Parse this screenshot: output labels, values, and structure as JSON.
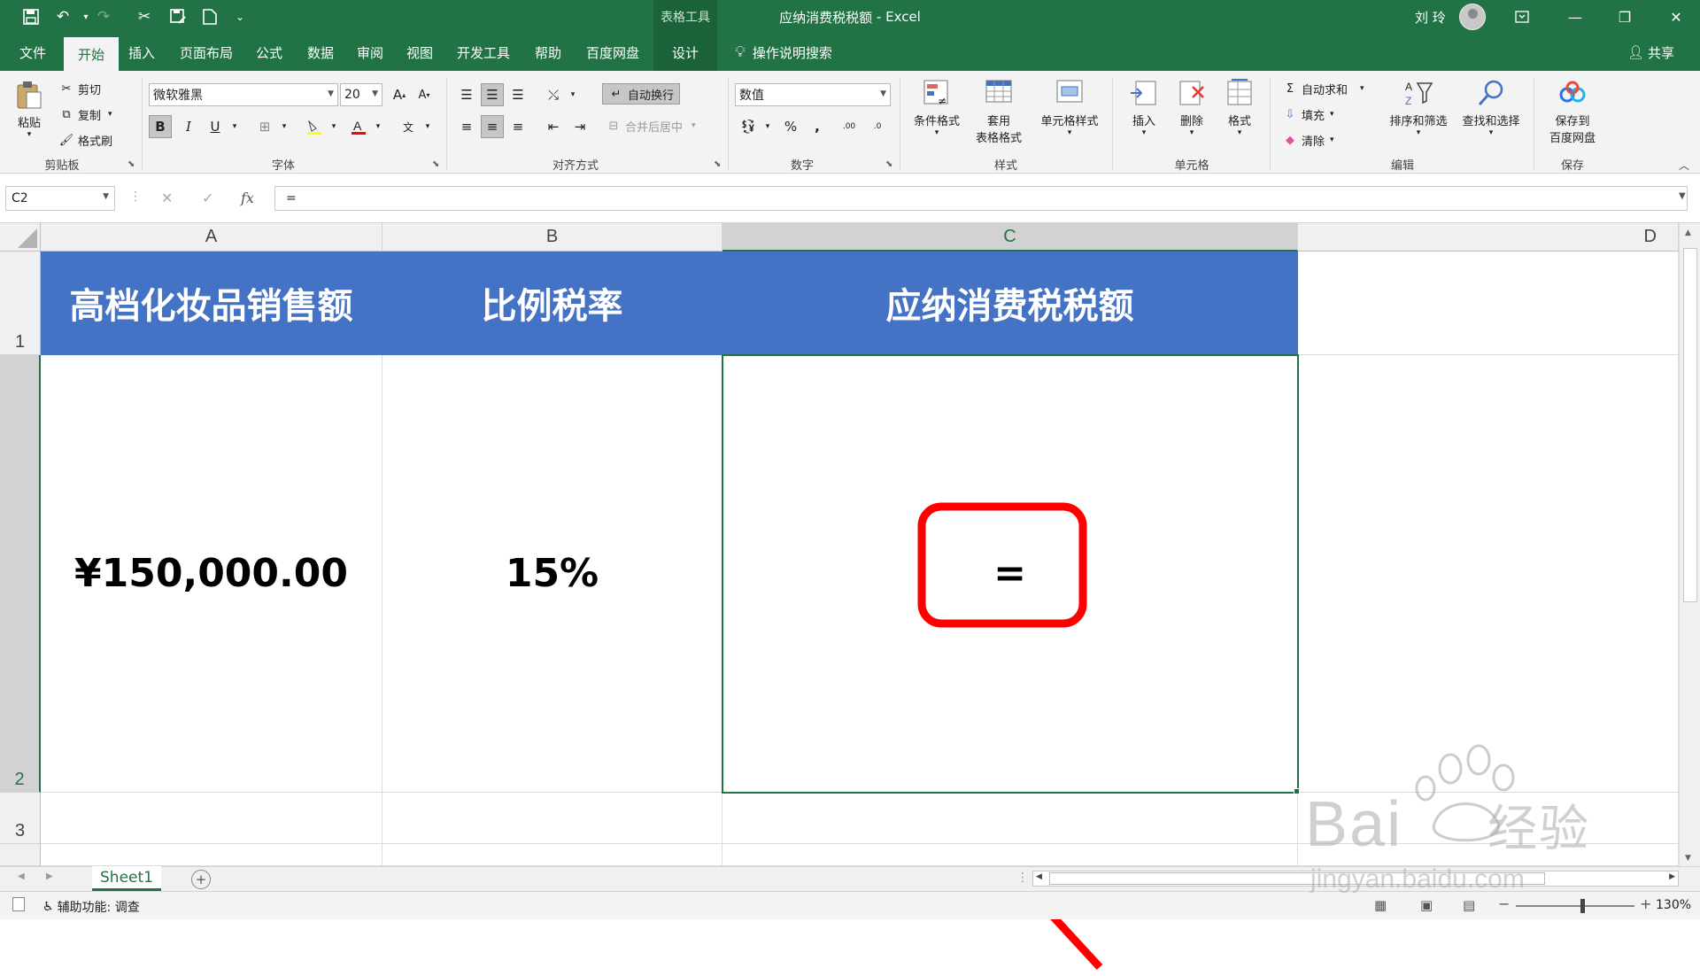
{
  "window": {
    "context_tab": "表格工具",
    "title": "应纳消费税税额",
    "app_name": "Excel",
    "title_separator": " - ",
    "user": "刘 玲"
  },
  "tabs": [
    "文件",
    "开始",
    "插入",
    "页面布局",
    "公式",
    "数据",
    "审阅",
    "视图",
    "开发工具",
    "帮助",
    "百度网盘",
    "设计"
  ],
  "active_tab": "开始",
  "tell_me": "操作说明搜索",
  "share": "共享",
  "ribbon": {
    "clipboard": {
      "paste": "粘贴",
      "cut": "剪切",
      "copy": "复制",
      "format_painter": "格式刷",
      "label": "剪贴板"
    },
    "font": {
      "name": "微软雅黑",
      "size": "20",
      "label": "字体",
      "bold": "B",
      "italic": "I",
      "underline": "U",
      "grow": "A",
      "shrink": "A",
      "phonetic": "文"
    },
    "alignment": {
      "wrap_text": "自动换行",
      "merge_center": "合并后居中",
      "label": "对齐方式"
    },
    "number": {
      "format": "数值",
      "percent": "%",
      "comma": ",",
      "inc_decimal": ".00",
      "dec_decimal": ".0",
      "label": "数字"
    },
    "styles": {
      "conditional": "条件格式",
      "table_line1": "套用",
      "table_line2": "表格格式",
      "cell_styles": "单元格样式",
      "label": "样式"
    },
    "cells": {
      "insert": "插入",
      "delete": "删除",
      "format": "格式",
      "label": "单元格"
    },
    "editing": {
      "autosum": "自动求和",
      "fill": "填充",
      "clear": "清除",
      "sort_filter": "排序和筛选",
      "find_select": "查找和选择",
      "label": "编辑"
    },
    "save": {
      "line1": "保存到",
      "line2": "百度网盘",
      "label": "保存"
    }
  },
  "formula_bar": {
    "name_box": "C2",
    "formula": "=",
    "fx": "fx"
  },
  "columns": [
    "A",
    "B",
    "C",
    "D"
  ],
  "rows": [
    "1",
    "2",
    "3"
  ],
  "cells": {
    "A1": "高档化妆品销售额",
    "B1": "比例税率",
    "C1": "应纳消费税税额",
    "A2": "¥150,000.00",
    "B2": "15%",
    "C2": "="
  },
  "selected_cell": "C2",
  "sheets": [
    "Sheet1"
  ],
  "status": {
    "accessibility": "辅助功能: 调查",
    "zoom": "130%",
    "zoom_fraction": 0.56
  },
  "colors": {
    "excel_green": "#217346",
    "header_fill": "#4472c4",
    "annotation_red": "#ff0000"
  },
  "watermark": {
    "brand": "Bai",
    "brand_cn": "经验",
    "site": "jingyan.baidu.com"
  }
}
